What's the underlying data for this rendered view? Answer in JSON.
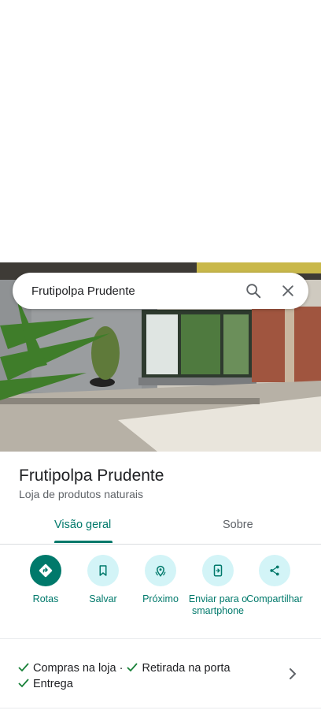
{
  "search": {
    "query": "Frutipolpa Prudente"
  },
  "place": {
    "name": "Frutipolpa Prudente",
    "category": "Loja de produtos naturais"
  },
  "tabs": [
    {
      "label": "Visão geral",
      "active": true
    },
    {
      "label": "Sobre",
      "active": false
    }
  ],
  "actions": [
    {
      "label": "Rotas",
      "icon": "directions-icon"
    },
    {
      "label": "Salvar",
      "icon": "bookmark-icon"
    },
    {
      "label": "Próximo",
      "icon": "nearby-icon"
    },
    {
      "label": "Enviar para o smartphone",
      "icon": "send-to-phone-icon"
    },
    {
      "label": "Compartilhar",
      "icon": "share-icon"
    }
  ],
  "services": {
    "items": [
      "Compras na loja",
      "Retirada na porta",
      "Entrega"
    ],
    "separator": "·"
  },
  "colors": {
    "accent": "#00796b",
    "chip_bg": "#d3f4f7",
    "check": "#188038"
  }
}
